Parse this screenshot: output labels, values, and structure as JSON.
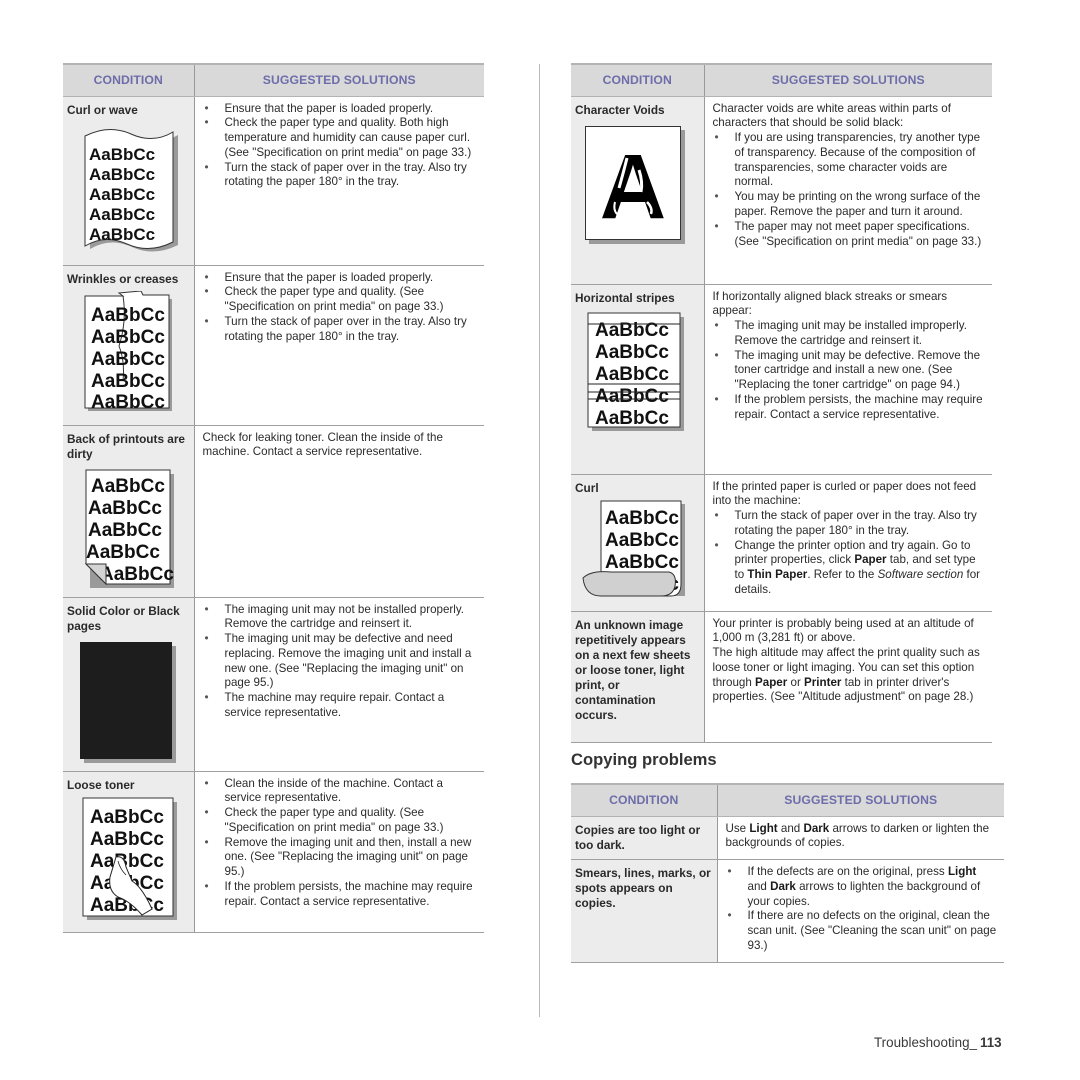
{
  "headers": {
    "condition": "CONDITION",
    "solutions": "SUGGESTED SOLUTIONS"
  },
  "sample_text": "AaBbCc",
  "void_letter": "A",
  "left_table": [
    {
      "condition": "Curl or wave",
      "illustration": "wavy-paper-sample",
      "bullets": [
        "Ensure that the paper is loaded properly.",
        "Check the paper type and quality. Both high temperature and humidity can cause paper curl. (See \"Specification on print media\" on page 33.)",
        "Turn the stack of paper over in the tray. Also try rotating the paper 180° in the tray."
      ]
    },
    {
      "condition": "Wrinkles or creases",
      "illustration": "creased-paper-sample",
      "bullets": [
        "Ensure that the paper is loaded properly.",
        "Check the paper type and quality. (See \"Specification on print media\" on page 33.)",
        "Turn the stack of paper over in the tray. Also try rotating the paper 180° in the tray."
      ]
    },
    {
      "condition": "Back of printouts are dirty",
      "illustration": "folded-corner-paper-sample",
      "text": "Check for leaking toner. Clean the inside of the machine. Contact a service representative."
    },
    {
      "condition": "Solid Color or Black pages",
      "illustration": "solid-black-page",
      "bullets": [
        "The imaging unit may not be installed properly. Remove the cartridge and reinsert it.",
        "The imaging unit may be defective and need replacing. Remove the imaging unit and install a new one. (See \"Replacing the imaging unit\" on page 95.)",
        "The machine may require repair. Contact a service representative."
      ]
    },
    {
      "condition": "Loose toner",
      "illustration": "smeared-toner-sample",
      "bullets": [
        "Clean the inside of the machine. Contact a service representative.",
        "Check the paper type and quality. (See \"Specification on print media\" on page 33.)",
        "Remove the imaging unit and then, install a new one. (See \"Replacing the imaging unit\" on page 95.)",
        "If the problem persists, the machine may require repair. Contact a service representative."
      ]
    }
  ],
  "right_table": [
    {
      "condition": "Character Voids",
      "illustration": "character-void-sample",
      "intro": "Character voids are white areas within parts of characters that should be solid black:",
      "bullets": [
        "If you are using transparencies, try another type of transparency. Because of the composition of transparencies, some character voids are normal.",
        "You may be printing on the wrong surface of the paper. Remove the paper and turn it around.",
        "The paper may not meet paper specifications. (See \"Specification on print media\" on page 33.)"
      ]
    },
    {
      "condition": "Horizontal stripes",
      "illustration": "horizontal-stripes-sample",
      "intro": "If horizontally aligned black streaks or smears appear:",
      "bullets": [
        "The imaging unit may be installed improperly. Remove the cartridge and reinsert it.",
        "The imaging unit may be defective. Remove the toner cartridge and install a new one. (See \"Replacing the toner cartridge\" on page 94.)",
        "If the problem persists, the machine may require repair. Contact a service representative."
      ]
    },
    {
      "condition": "Curl",
      "illustration": "curled-paper-sample",
      "intro": "If the printed paper is curled or paper does not feed into the machine:",
      "bullets": [
        "Turn the stack of paper over in the tray. Also try rotating the paper 180° in the tray."
      ],
      "bullet2": {
        "a": "Change the printer option and try again. Go to printer properties, click ",
        "b1": "Paper",
        "c": " tab, and set type to ",
        "b2": "Thin Paper",
        "d": ". Refer to the ",
        "i": "Software section",
        "e": " for details."
      }
    },
    {
      "condition": "An unknown image repetitively appears on a next few sheets or loose toner, light print, or contamination occurs.",
      "line1": "Your printer is probably being used at an altitude of 1,000 m (3,281 ft) or above.",
      "line2": {
        "a": "The high altitude may affect the print quality such as loose toner or light imaging. You can set this option through ",
        "b1": "Paper",
        "c": " or ",
        "b2": "Printer",
        "d": " tab in printer driver's properties. (See \"Altitude adjustment\" on page 28.)"
      }
    }
  ],
  "copying": {
    "title": "Copying problems",
    "rows": [
      {
        "condition": "Copies are too light or too dark.",
        "a": "Use ",
        "b1": "Light",
        "c": " and ",
        "b2": "Dark",
        "d": " arrows to darken or lighten the backgrounds of copies."
      },
      {
        "condition": "Smears, lines, marks, or spots appears on copies.",
        "bullet1": {
          "a": "If the defects are on the original, press ",
          "b1": "Light",
          "c": " and ",
          "b2": "Dark",
          "d": " arrows to lighten the background of your copies."
        },
        "bullet2": "If there are no defects on the original, clean the scan unit. (See \"Cleaning the scan unit\" on page 93.)"
      }
    ]
  },
  "footer": {
    "section": "Troubleshooting_",
    "page": "113"
  }
}
